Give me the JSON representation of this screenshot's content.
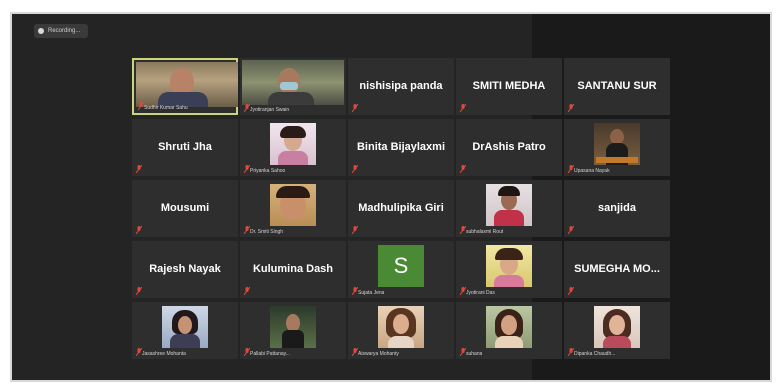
{
  "recording": {
    "label": "Recording..."
  },
  "colors": {
    "accent_border": "#c8d57a",
    "mic_muted": "#e0483d",
    "avatar_green": "#4b8a34"
  },
  "participants": [
    {
      "name": "",
      "label": "Sudhir Kumar Sahu",
      "type": "video",
      "active": true
    },
    {
      "name": "",
      "label": "Jyotiranjan Swain",
      "type": "video"
    },
    {
      "name": "nishisipa panda",
      "label": "",
      "type": "name"
    },
    {
      "name": "SMITI MEDHA",
      "label": "",
      "type": "name"
    },
    {
      "name": "SANTANU SUR",
      "label": "",
      "type": "name"
    },
    {
      "name": "Shruti Jha",
      "label": "",
      "type": "name"
    },
    {
      "name": "",
      "label": "Priyanka Sahoo",
      "type": "photo"
    },
    {
      "name": "Binita Bijaylaxmi",
      "label": "",
      "type": "name"
    },
    {
      "name": "DrAshis Patro",
      "label": "",
      "type": "name"
    },
    {
      "name": "",
      "label": "Upasana Nayak",
      "type": "photo"
    },
    {
      "name": "Mousumi",
      "label": "",
      "type": "name"
    },
    {
      "name": "",
      "label": "Dr. Smiti Singh",
      "type": "photo"
    },
    {
      "name": "Madhulipika Giri",
      "label": "",
      "type": "name"
    },
    {
      "name": "",
      "label": "subhalaxmi Rout",
      "type": "photo"
    },
    {
      "name": "sanjida",
      "label": "",
      "type": "name"
    },
    {
      "name": "Rajesh  Nayak",
      "label": "",
      "type": "name"
    },
    {
      "name": "Kulumina Dash",
      "label": "",
      "type": "name"
    },
    {
      "name": "",
      "label": "Sujata Jena",
      "type": "avatar",
      "letter": "S"
    },
    {
      "name": "",
      "label": "Jyotirani Das",
      "type": "photo"
    },
    {
      "name": "SUMEGHA  MO...",
      "label": "",
      "type": "name"
    },
    {
      "name": "",
      "label": "Jasashree Mohanta",
      "type": "photo"
    },
    {
      "name": "",
      "label": "Pallabi Pattanay...",
      "type": "photo"
    },
    {
      "name": "",
      "label": "Aiswarya Mohanty",
      "type": "photo"
    },
    {
      "name": "",
      "label": "suhana",
      "type": "photo"
    },
    {
      "name": "",
      "label": "Dipanka Chaudh...",
      "type": "photo"
    }
  ]
}
